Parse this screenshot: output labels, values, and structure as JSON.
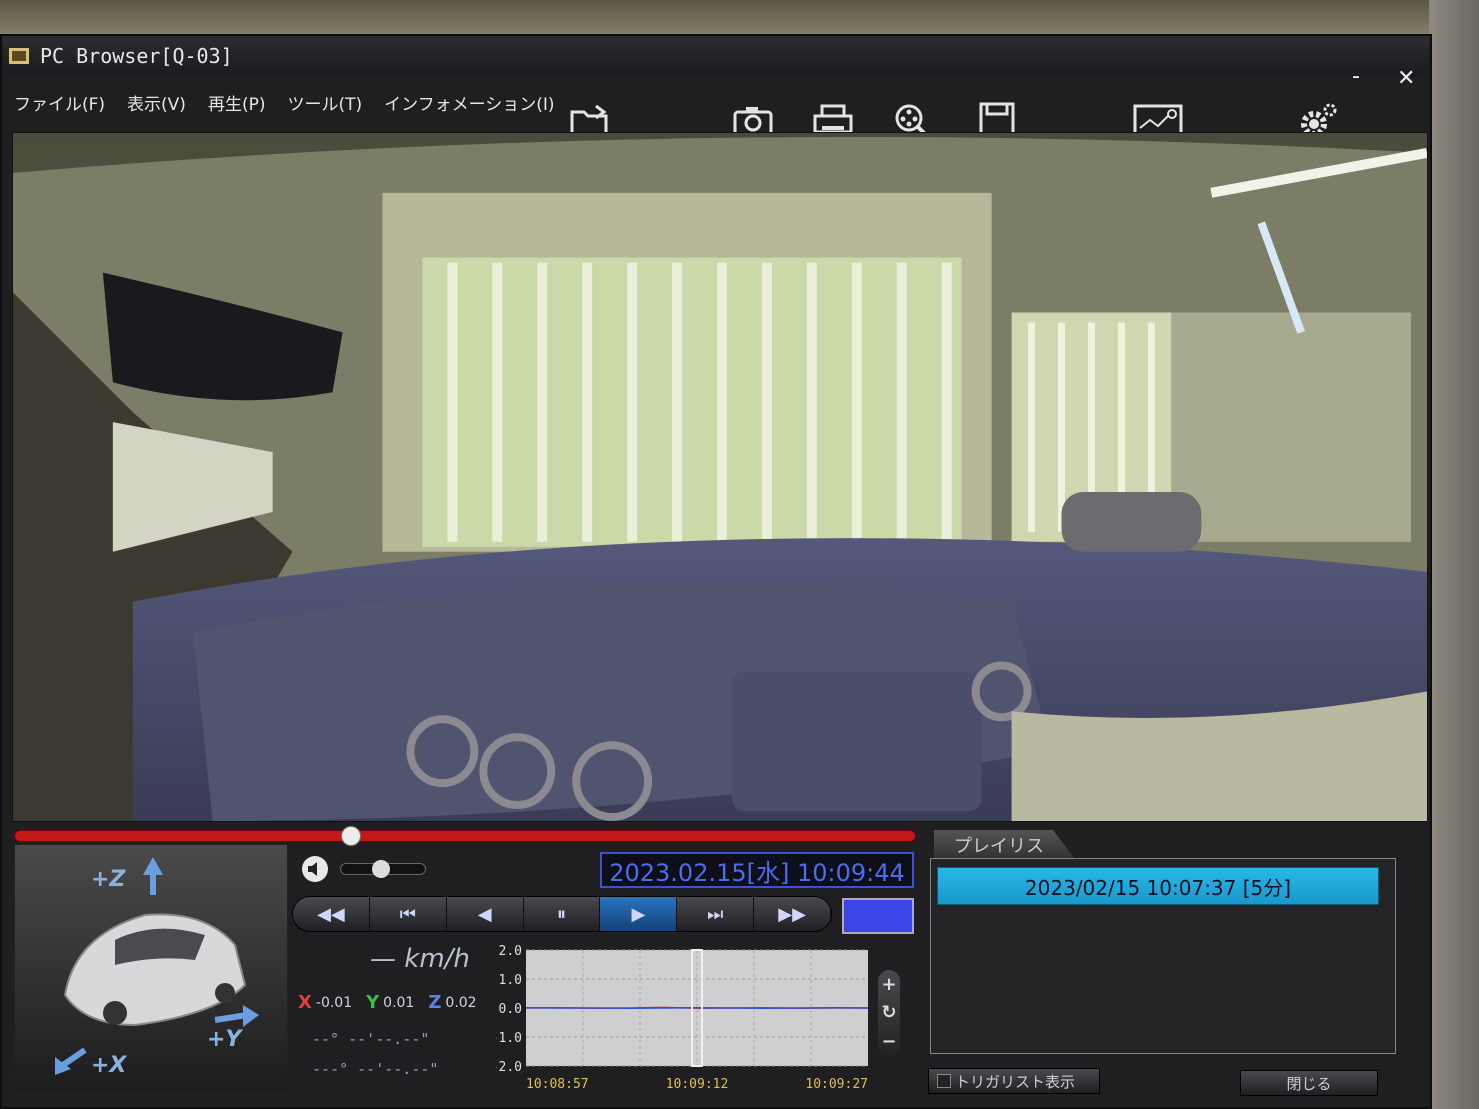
{
  "window": {
    "title": "PC Browser[Q-03]",
    "minimize_glyph": "-",
    "close_glyph": "✕"
  },
  "menu": [
    {
      "label": "ファイル(F)"
    },
    {
      "label": "表示(V)"
    },
    {
      "label": "再生(P)"
    },
    {
      "label": "ツール(T)"
    },
    {
      "label": "インフォメーション(I)"
    }
  ],
  "toolbar": {
    "icons": [
      "open-folder-icon",
      "camera-icon",
      "print-icon",
      "search-icon",
      "save-icon",
      "map-icon",
      "settings-icon"
    ]
  },
  "playback": {
    "seek_progress": 0.37,
    "volume_level": 0.45,
    "datetime": "2023.02.15[水] 10:09:44",
    "buttons": [
      "◀◀",
      "⏮",
      "◀",
      "⏸",
      "▶",
      "⏭",
      "▶▶"
    ],
    "active_button_index": 4,
    "swatch_color": "#3c46e8"
  },
  "playlist": {
    "tab_label": "プレイリスト",
    "entries": [
      {
        "label": "2023/02/15 10:07:37 [5分]"
      }
    ]
  },
  "car_axes": {
    "z": "+Z",
    "y": "+Y",
    "x": "+X"
  },
  "telemetry": {
    "speed": "— km/h",
    "x_label": "X",
    "x_value": "-0.01",
    "y_label": "Y",
    "y_value": "0.01",
    "z_label": "Z",
    "z_value": "0.02",
    "coord_line1": "--° --'--.--\"",
    "coord_line2": "---° --'--.--\""
  },
  "chart_data": {
    "type": "line",
    "ylim": [
      -2.0,
      2.0
    ],
    "y_ticks": [
      "2.0",
      "1.0",
      "0.0",
      "-1.0",
      "-2.0"
    ],
    "x_ticks": [
      "10:08:57",
      "10:09:12",
      "10:09:27"
    ],
    "series": [
      {
        "color": "#d03030",
        "values": [
          0.0,
          0.01,
          -0.01,
          0.0,
          0.02,
          -0.01,
          0.0,
          0.01,
          -0.01,
          0.0,
          0.0
        ]
      },
      {
        "color": "#3050d0",
        "values": [
          0.01,
          0.0,
          0.0,
          -0.01,
          0.0,
          0.01,
          0.0,
          -0.01,
          0.0,
          0.01,
          0.0
        ]
      }
    ],
    "cursor_fraction": 0.5,
    "grid": true
  },
  "zoom": {
    "plus": "+",
    "reset": "↻",
    "minus": "−"
  },
  "footer": {
    "trigger_label": "トリガリスト表示",
    "close_label": "閉じる"
  }
}
